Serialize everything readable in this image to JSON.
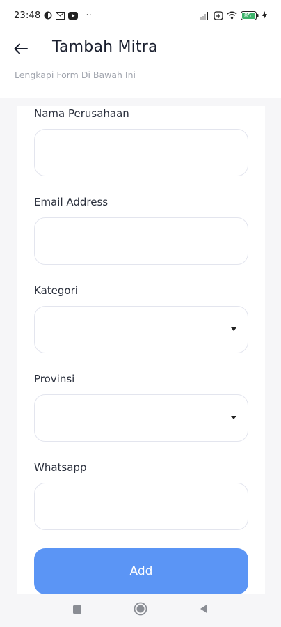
{
  "status_bar": {
    "time": "23:48",
    "dots": "··",
    "battery": "85",
    "icons": [
      "app-notification-icon",
      "mail-icon",
      "youtube-icon",
      "signal-icon",
      "network-icon",
      "wifi-icon",
      "battery-icon",
      "charging-icon"
    ]
  },
  "header": {
    "title": "Tambah Mitra",
    "subtitle": "Lengkapi Form Di Bawah Ini"
  },
  "form": {
    "fields": [
      {
        "label": "Nama Perusahaan",
        "value": "",
        "type": "text"
      },
      {
        "label": "Email Address",
        "value": "",
        "type": "text"
      },
      {
        "label": "Kategori",
        "value": "",
        "type": "dropdown"
      },
      {
        "label": "Provinsi",
        "value": "",
        "type": "dropdown"
      },
      {
        "label": "Whatsapp",
        "value": "",
        "type": "text"
      }
    ],
    "submit_label": "Add"
  },
  "colors": {
    "accent": "#5b95f5",
    "background": "#f6f6f8",
    "card": "#ffffff"
  }
}
